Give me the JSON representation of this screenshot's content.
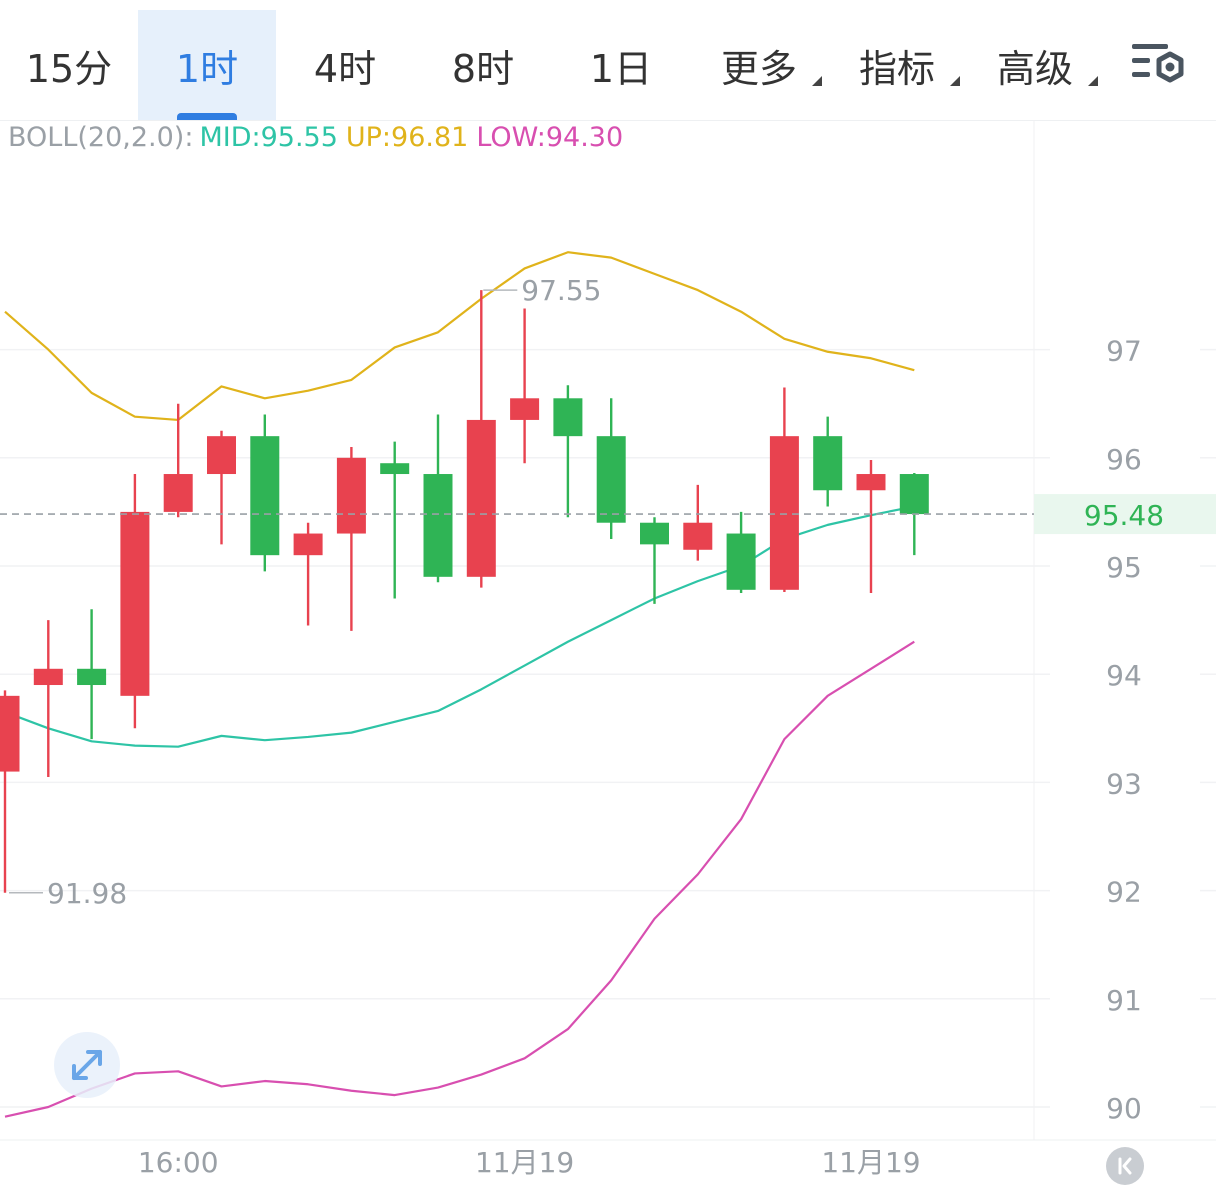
{
  "tabs": [
    {
      "label": "15分",
      "active": false,
      "dropdown": false
    },
    {
      "label": "1时",
      "active": true,
      "dropdown": false
    },
    {
      "label": "4时",
      "active": false,
      "dropdown": false
    },
    {
      "label": "8时",
      "active": false,
      "dropdown": false
    },
    {
      "label": "1日",
      "active": false,
      "dropdown": false
    },
    {
      "label": "更多",
      "active": false,
      "dropdown": true
    },
    {
      "label": "指标",
      "active": false,
      "dropdown": true
    },
    {
      "label": "高级",
      "active": false,
      "dropdown": true
    }
  ],
  "settings_icon": "chart-settings-icon",
  "indicator": {
    "name": "BOLL(20,2.0):",
    "mid": "MID:95.55",
    "up": "UP:96.81",
    "low": "LOW:94.30"
  },
  "colors": {
    "accent": "#2f7de1",
    "rise": "#e8424f",
    "fall": "#2fb455",
    "mid": "#2ec4a6",
    "up": "#e0b31b",
    "low": "#d84fb0",
    "current_price": "#2fb455"
  },
  "chart_data": {
    "type": "candlestick",
    "y_ticks": [
      90,
      91,
      92,
      93,
      94,
      95,
      96,
      97
    ],
    "ylim": [
      89.98,
      98.46
    ],
    "x_tick_labels": [
      {
        "index": 4,
        "label": "16:00"
      },
      {
        "index": 12,
        "label": "11月19"
      },
      {
        "index": 20,
        "label": "11月19"
      }
    ],
    "current_price": 95.48,
    "current_price_label": "95.48",
    "high_annotation": {
      "index": 11,
      "value": 97.55,
      "label": "97.55"
    },
    "low_annotation": {
      "index": 0,
      "value": 91.98,
      "label": "91.98"
    },
    "candles": [
      {
        "open": 93.1,
        "high": 93.85,
        "low": 91.98,
        "close": 93.8
      },
      {
        "open": 93.9,
        "high": 94.5,
        "low": 93.05,
        "close": 94.05
      },
      {
        "open": 94.05,
        "high": 94.6,
        "low": 93.4,
        "close": 93.9
      },
      {
        "open": 93.8,
        "high": 95.85,
        "low": 93.5,
        "close": 95.5
      },
      {
        "open": 95.5,
        "high": 96.5,
        "low": 95.45,
        "close": 95.85
      },
      {
        "open": 95.85,
        "high": 96.25,
        "low": 95.2,
        "close": 96.2
      },
      {
        "open": 96.2,
        "high": 96.4,
        "low": 94.95,
        "close": 95.1
      },
      {
        "open": 95.1,
        "high": 95.4,
        "low": 94.45,
        "close": 95.3
      },
      {
        "open": 95.3,
        "high": 96.1,
        "low": 94.4,
        "close": 96.0
      },
      {
        "open": 95.95,
        "high": 96.15,
        "low": 94.7,
        "close": 95.85
      },
      {
        "open": 95.85,
        "high": 96.4,
        "low": 94.85,
        "close": 94.9
      },
      {
        "open": 94.9,
        "high": 97.55,
        "low": 94.8,
        "close": 96.35
      },
      {
        "open": 96.35,
        "high": 97.38,
        "low": 95.95,
        "close": 96.55
      },
      {
        "open": 96.55,
        "high": 96.67,
        "low": 95.45,
        "close": 96.2
      },
      {
        "open": 96.2,
        "high": 96.55,
        "low": 95.25,
        "close": 95.4
      },
      {
        "open": 95.4,
        "high": 95.45,
        "low": 94.65,
        "close": 95.2
      },
      {
        "open": 95.15,
        "high": 95.75,
        "low": 95.05,
        "close": 95.4
      },
      {
        "open": 95.3,
        "high": 95.5,
        "low": 94.75,
        "close": 94.78
      },
      {
        "open": 94.78,
        "high": 96.65,
        "low": 94.76,
        "close": 96.2
      },
      {
        "open": 96.2,
        "high": 96.38,
        "low": 95.55,
        "close": 95.7
      },
      {
        "open": 95.7,
        "high": 95.98,
        "low": 94.75,
        "close": 95.85
      },
      {
        "open": 95.85,
        "high": 95.86,
        "low": 95.1,
        "close": 95.48
      }
    ],
    "series": [
      {
        "name": "UP",
        "values": [
          97.35,
          97.0,
          96.6,
          96.38,
          96.35,
          96.66,
          96.55,
          96.62,
          96.72,
          97.02,
          97.16,
          97.47,
          97.75,
          97.9,
          97.85,
          97.7,
          97.55,
          97.35,
          97.1,
          96.98,
          96.92,
          96.81
        ]
      },
      {
        "name": "MID",
        "values": [
          93.65,
          93.5,
          93.38,
          93.34,
          93.33,
          93.43,
          93.39,
          93.42,
          93.46,
          93.56,
          93.66,
          93.86,
          94.08,
          94.3,
          94.5,
          94.7,
          94.86,
          95.0,
          95.25,
          95.38,
          95.47,
          95.55
        ]
      },
      {
        "name": "LOW",
        "values": [
          89.91,
          90.0,
          90.17,
          90.31,
          90.33,
          90.19,
          90.24,
          90.21,
          90.15,
          90.11,
          90.18,
          90.3,
          90.45,
          90.72,
          91.17,
          91.74,
          92.15,
          92.66,
          93.4,
          93.8,
          94.05,
          94.3
        ]
      }
    ]
  }
}
